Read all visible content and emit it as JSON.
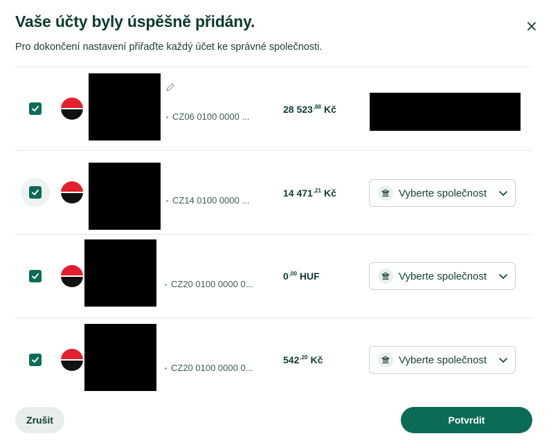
{
  "dialog": {
    "title": "Vaše účty byly úspěšně přidány.",
    "subtitle": "Pro dokončení nastavení přiřaďte každý účet ke správné společnosti.",
    "close_icon": "close-icon"
  },
  "accounts": [
    {
      "checked": true,
      "bank_icon": "bank-logo-icon",
      "iban": "CZ06 0100 0000 ...",
      "amount_int": "28 523",
      "amount_dec": ",88",
      "currency": "Kč",
      "company_placeholder": ""
    },
    {
      "checked": true,
      "bank_icon": "bank-logo-icon",
      "iban": "CZ14 0100 0000 ...",
      "amount_int": "14 471",
      "amount_dec": ",21",
      "currency": "Kč",
      "company_placeholder": "Vyberte společnost"
    },
    {
      "checked": true,
      "bank_icon": "bank-logo-icon",
      "iban": "CZ20 0100 0000 0...",
      "amount_int": "0",
      "amount_dec": ",00",
      "currency": "HUF",
      "company_placeholder": "Vyberte společnost"
    },
    {
      "checked": true,
      "bank_icon": "bank-logo-icon",
      "iban": "CZ20 0100 0000 0...",
      "amount_int": "542",
      "amount_dec": ",20",
      "currency": "Kč",
      "company_placeholder": "Vyberte společnost"
    }
  ],
  "footer": {
    "cancel_label": "Zrušit",
    "confirm_label": "Potvrdit"
  },
  "colors": {
    "primary": "#0c6b57",
    "title": "#0b3a2c",
    "bank_red": "#e5202e"
  }
}
